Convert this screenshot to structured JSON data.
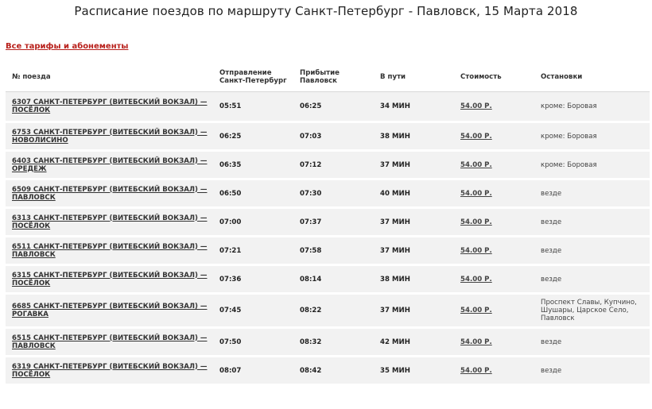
{
  "page": {
    "title": "Расписание поездов по маршруту Санкт-Петербург - Павловск, 15 Марта 2018",
    "all_fares_link": "Все тарифы и абонементы"
  },
  "table": {
    "headers": {
      "train": "№ поезда",
      "departure_line1": "Отправление",
      "departure_line2": "Санкт-Петербург",
      "arrival_line1": "Прибытие",
      "arrival_line2": "Павловск",
      "duration": "В пути",
      "price": "Стоимость",
      "stops": "Остановки"
    },
    "rows": [
      {
        "train_line1": "6307 САНКТ-ПЕТЕРБУРГ (ВИТЕБСКИЙ ВОКЗАЛ) —",
        "train_line2": "ПОСЁЛОК",
        "departure": "05:51",
        "arrival": "06:25",
        "duration": "34 МИН",
        "price": "54.00 Р.",
        "stops": "кроме: Боровая"
      },
      {
        "train_line1": "6753 САНКТ-ПЕТЕРБУРГ (ВИТЕБСКИЙ ВОКЗАЛ) —",
        "train_line2": "НОВОЛИСИНО",
        "departure": "06:25",
        "arrival": "07:03",
        "duration": "38 МИН",
        "price": "54.00 Р.",
        "stops": "кроме: Боровая"
      },
      {
        "train_line1": "6403 САНКТ-ПЕТЕРБУРГ (ВИТЕБСКИЙ ВОКЗАЛ) —",
        "train_line2": "ОРЕДЕЖ",
        "departure": "06:35",
        "arrival": "07:12",
        "duration": "37 МИН",
        "price": "54.00 Р.",
        "stops": "кроме: Боровая"
      },
      {
        "train_line1": "6509 САНКТ-ПЕТЕРБУРГ (ВИТЕБСКИЙ ВОКЗАЛ) —",
        "train_line2": "ПАВЛОВСК",
        "departure": "06:50",
        "arrival": "07:30",
        "duration": "40 МИН",
        "price": "54.00 Р.",
        "stops": "везде"
      },
      {
        "train_line1": "6313 САНКТ-ПЕТЕРБУРГ (ВИТЕБСКИЙ ВОКЗАЛ) —",
        "train_line2": "ПОСЁЛОК",
        "departure": "07:00",
        "arrival": "07:37",
        "duration": "37 МИН",
        "price": "54.00 Р.",
        "stops": "везде"
      },
      {
        "train_line1": "6511 САНКТ-ПЕТЕРБУРГ (ВИТЕБСКИЙ ВОКЗАЛ) —",
        "train_line2": "ПАВЛОВСК",
        "departure": "07:21",
        "arrival": "07:58",
        "duration": "37 МИН",
        "price": "54.00 Р.",
        "stops": "везде"
      },
      {
        "train_line1": "6315 САНКТ-ПЕТЕРБУРГ (ВИТЕБСКИЙ ВОКЗАЛ) —",
        "train_line2": "ПОСЁЛОК",
        "departure": "07:36",
        "arrival": "08:14",
        "duration": "38 МИН",
        "price": "54.00 Р.",
        "stops": "везде"
      },
      {
        "train_line1": "6685 САНКТ-ПЕТЕРБУРГ (ВИТЕБСКИЙ ВОКЗАЛ) —",
        "train_line2": "РОГАВКА",
        "departure": "07:45",
        "arrival": "08:22",
        "duration": "37 МИН",
        "price": "54.00 Р.",
        "stops": "Проспект Славы, Купчино, Шушары, Царское Село, Павловск"
      },
      {
        "train_line1": "6515 САНКТ-ПЕТЕРБУРГ (ВИТЕБСКИЙ ВОКЗАЛ) —",
        "train_line2": "ПАВЛОВСК",
        "departure": "07:50",
        "arrival": "08:32",
        "duration": "42 МИН",
        "price": "54.00 Р.",
        "stops": "везде"
      },
      {
        "train_line1": "6319 САНКТ-ПЕТЕРБУРГ (ВИТЕБСКИЙ ВОКЗАЛ) —",
        "train_line2": "ПОСЁЛОК",
        "departure": "08:07",
        "arrival": "08:42",
        "duration": "35 МИН",
        "price": "54.00 Р.",
        "stops": "везде"
      }
    ]
  }
}
